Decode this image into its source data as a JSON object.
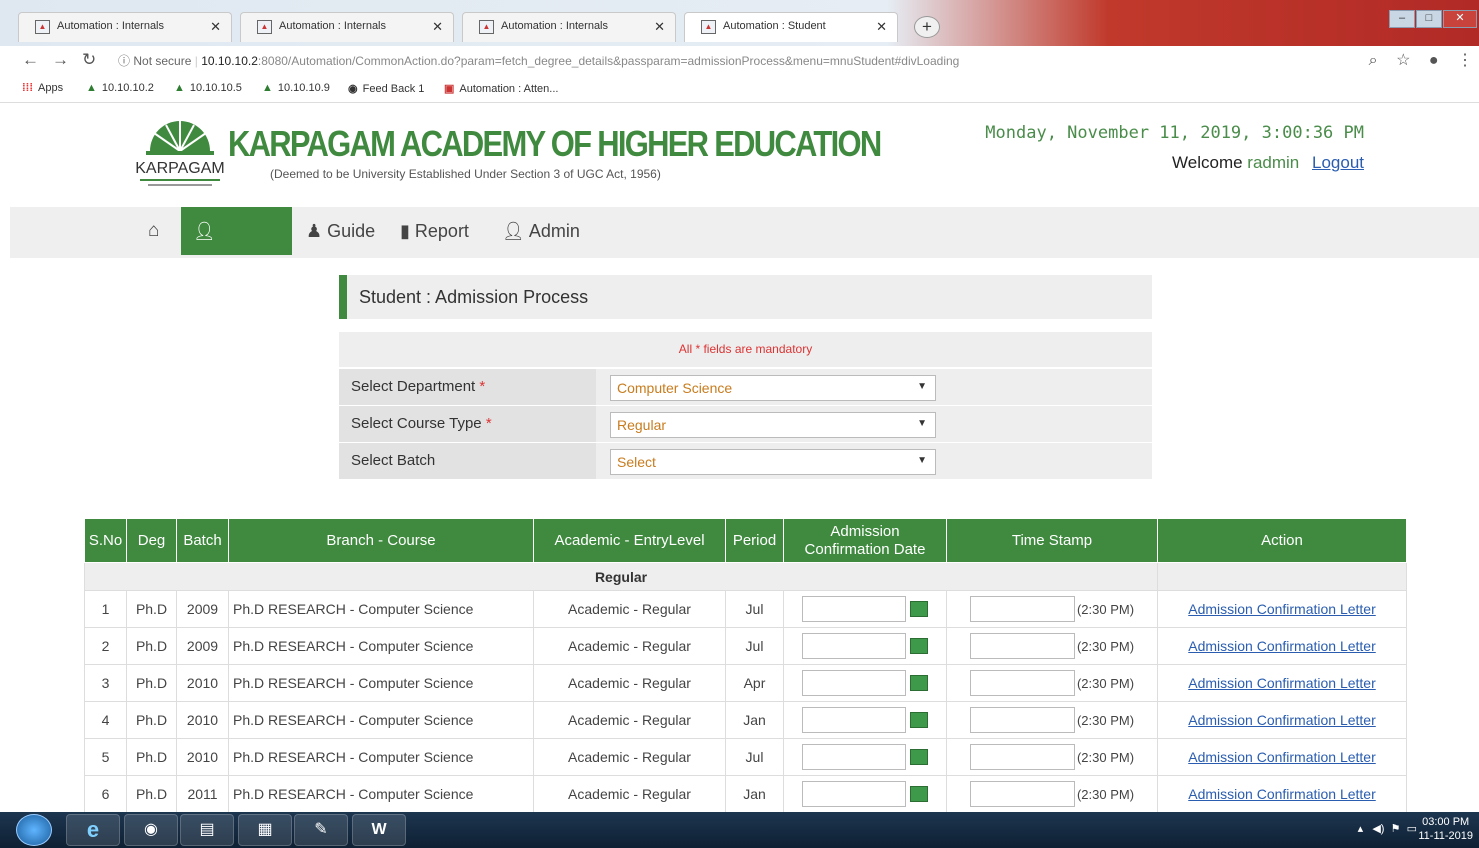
{
  "browser": {
    "tabs": [
      {
        "title": "Automation : Internals",
        "active": false
      },
      {
        "title": "Automation : Internals",
        "active": false
      },
      {
        "title": "Automation : Internals",
        "active": false
      },
      {
        "title": "Automation : Student",
        "active": true
      }
    ],
    "security": "Not secure",
    "url_host": "10.10.10.2",
    "url_rest": ":8080/Automation/CommonAction.do?param=fetch_degree_details&passparam=admissionProcess&menu=mnuStudent#divLoading",
    "bookmarks": [
      "Apps",
      "10.10.10.2",
      "10.10.10.5",
      "10.10.10.9",
      "Feed Back 1",
      "Automation : Atten..."
    ]
  },
  "header": {
    "logo_text": "KARPAGAM",
    "title": "KARPAGAM ACADEMY OF HIGHER EDUCATION",
    "subtitle": "(Deemed to be University Established Under Section 3 of UGC Act, 1956)",
    "datetime": "Monday, November 11, 2019, 3:00:36 PM",
    "welcome": "Welcome",
    "username": "radmin",
    "logout": "Logout"
  },
  "menu": [
    {
      "label": "Student",
      "active": true
    },
    {
      "label": "Guide",
      "active": false
    },
    {
      "label": "Report",
      "active": false
    },
    {
      "label": "Admin",
      "active": false
    }
  ],
  "panel": {
    "title": "Student : Admission Process",
    "mandatory_note": "All * fields are mandatory",
    "fields": [
      {
        "label": "Select Department",
        "required": true,
        "value": "Computer Science"
      },
      {
        "label": "Select Course Type",
        "required": true,
        "value": "Regular"
      },
      {
        "label": "Select Batch",
        "required": false,
        "value": "Select"
      }
    ]
  },
  "table": {
    "headers": [
      "S.No",
      "Deg",
      "Batch",
      "Branch - Course",
      "Academic - EntryLevel",
      "Period",
      "Admission Confirmation Date",
      "Time Stamp",
      "Action"
    ],
    "group_label": "Regular",
    "rows": [
      {
        "sno": "1",
        "deg": "Ph.D",
        "batch": "2009",
        "branch": "Ph.D RESEARCH - Computer Science",
        "entry": "Academic - Regular",
        "period": "Jul",
        "time": "(2:30 PM)",
        "action": "Admission Confirmation Letter"
      },
      {
        "sno": "2",
        "deg": "Ph.D",
        "batch": "2009",
        "branch": "Ph.D RESEARCH - Computer Science",
        "entry": "Academic - Regular",
        "period": "Jul",
        "time": "(2:30 PM)",
        "action": "Admission Confirmation Letter"
      },
      {
        "sno": "3",
        "deg": "Ph.D",
        "batch": "2010",
        "branch": "Ph.D RESEARCH - Computer Science",
        "entry": "Academic - Regular",
        "period": "Apr",
        "time": "(2:30 PM)",
        "action": "Admission Confirmation Letter"
      },
      {
        "sno": "4",
        "deg": "Ph.D",
        "batch": "2010",
        "branch": "Ph.D RESEARCH - Computer Science",
        "entry": "Academic - Regular",
        "period": "Jan",
        "time": "(2:30 PM)",
        "action": "Admission Confirmation Letter"
      },
      {
        "sno": "5",
        "deg": "Ph.D",
        "batch": "2010",
        "branch": "Ph.D RESEARCH - Computer Science",
        "entry": "Academic - Regular",
        "period": "Jul",
        "time": "(2:30 PM)",
        "action": "Admission Confirmation Letter"
      },
      {
        "sno": "6",
        "deg": "Ph.D",
        "batch": "2011",
        "branch": "Ph.D RESEARCH - Computer Science",
        "entry": "Academic - Regular",
        "period": "Jan",
        "time": "(2:30 PM)",
        "action": "Admission Confirmation Letter"
      }
    ]
  },
  "taskbar": {
    "clock_time": "03:00 PM",
    "clock_date": "11-11-2019"
  },
  "colors": {
    "brand_green": "#3f8a3f",
    "link_blue": "#2a5db0",
    "required_red": "#d33"
  }
}
